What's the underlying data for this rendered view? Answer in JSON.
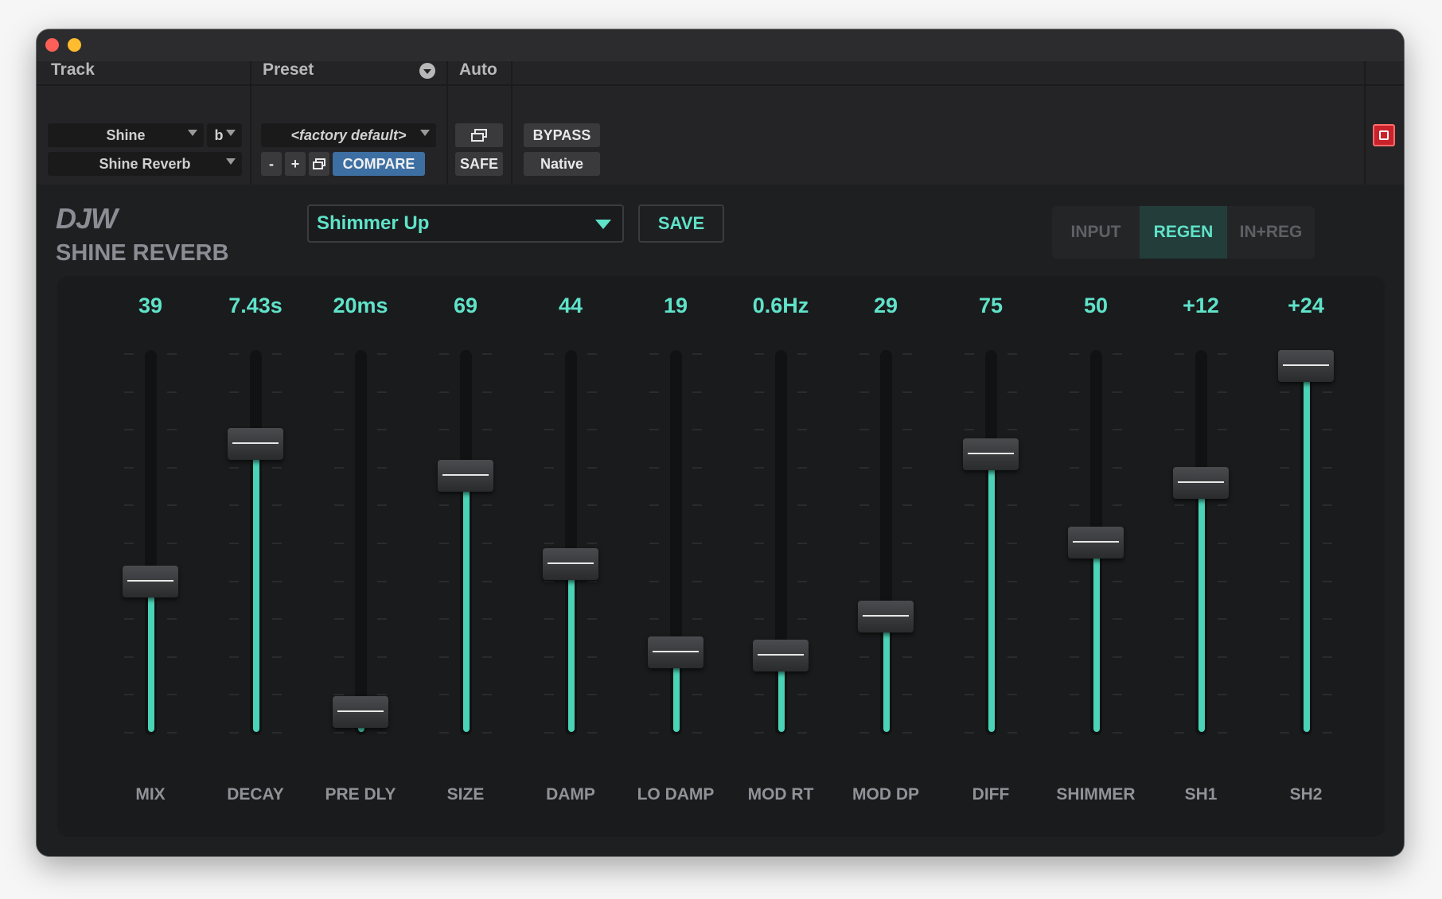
{
  "window": {
    "traffic_lights": [
      "close",
      "minimize"
    ]
  },
  "protools": {
    "track_label": "Track",
    "preset_label": "Preset",
    "auto_label": "Auto",
    "track_name": "Shine",
    "track_channel": "b",
    "insert_name": "Shine Reverb",
    "preset_name": "<factory default>",
    "minus_label": "-",
    "plus_label": "+",
    "compare_label": "COMPARE",
    "safe_label": "SAFE",
    "bypass_label": "BYPASS",
    "native_label": "Native"
  },
  "plugin": {
    "logo": "DJW",
    "name": "SHINE REVERB",
    "preset": "Shimmer Up",
    "save_label": "SAVE",
    "modes": [
      "INPUT",
      "REGEN",
      "IN+REG"
    ],
    "active_mode": "REGEN"
  },
  "faders": [
    {
      "label": "MIX",
      "value": "39",
      "level": 0.39
    },
    {
      "label": "DECAY",
      "value": "7.43s",
      "level": 0.78
    },
    {
      "label": "PRE DLY",
      "value": "20ms",
      "level": 0.02
    },
    {
      "label": "SIZE",
      "value": "69",
      "level": 0.69
    },
    {
      "label": "DAMP",
      "value": "44",
      "level": 0.44
    },
    {
      "label": "LO DAMP",
      "value": "19",
      "level": 0.19
    },
    {
      "label": "MOD RT",
      "value": "0.6Hz",
      "level": 0.18
    },
    {
      "label": "MOD DP",
      "value": "29",
      "level": 0.29
    },
    {
      "label": "DIFF",
      "value": "75",
      "level": 0.75
    },
    {
      "label": "SHIMMER",
      "value": "50",
      "level": 0.5
    },
    {
      "label": "SH1",
      "value": "+12",
      "level": 0.67
    },
    {
      "label": "SH2",
      "value": "+24",
      "level": 1.0
    }
  ],
  "colors": {
    "accent": "#5fe3c9",
    "fill": "#4ad3b6",
    "compare": "#3d6fa3"
  }
}
